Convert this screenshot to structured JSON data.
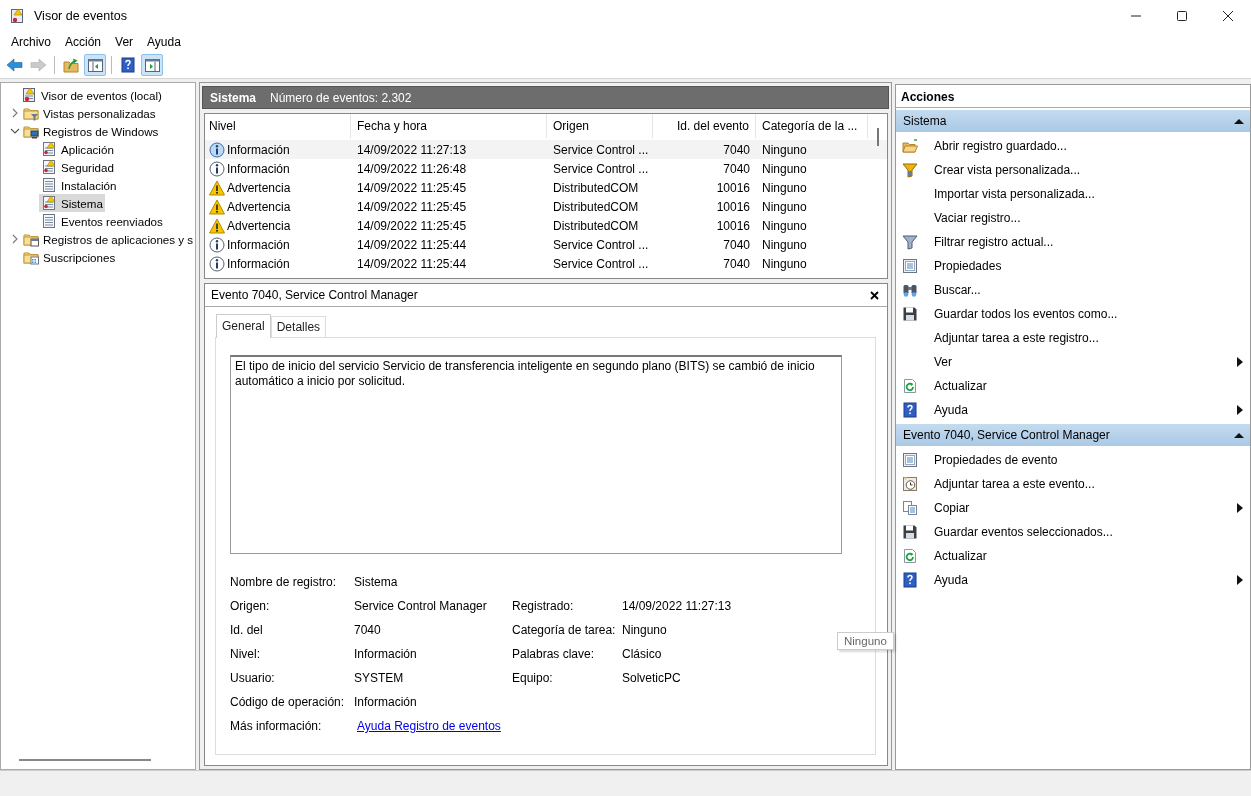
{
  "window": {
    "title": "Visor de eventos"
  },
  "menu": [
    "Archivo",
    "Acción",
    "Ver",
    "Ayuda"
  ],
  "toolbar": [
    {
      "kind": "back",
      "pressed": false,
      "disabled": false
    },
    {
      "kind": "forward",
      "pressed": false,
      "disabled": true
    },
    {
      "kind": "up",
      "pressed": false,
      "disabled": false
    },
    {
      "kind": "tree-pane",
      "pressed": true,
      "disabled": false
    },
    {
      "kind": "help",
      "pressed": false,
      "disabled": false
    },
    {
      "kind": "action-pane",
      "pressed": true,
      "disabled": false
    }
  ],
  "tree": [
    {
      "label": "Visor de eventos (local)",
      "kind": "viewer",
      "selected": false,
      "children": [
        {
          "label": "Vistas personalizadas",
          "kind": "folder-filter",
          "expanded": false,
          "selected": false
        },
        {
          "label": "Registros de Windows",
          "kind": "folder-computer",
          "expanded": true,
          "selected": false,
          "children": [
            {
              "label": "Aplicación",
              "kind": "log-alert",
              "selected": false
            },
            {
              "label": "Seguridad",
              "kind": "log-alert",
              "selected": false
            },
            {
              "label": "Instalación",
              "kind": "log",
              "selected": false
            },
            {
              "label": "Sistema",
              "kind": "log-alert",
              "selected": true
            },
            {
              "label": "Eventos reenviados",
              "kind": "log",
              "selected": false
            }
          ]
        },
        {
          "label": "Registros de aplicaciones y s",
          "kind": "folder-window",
          "expanded": false,
          "selected": false
        },
        {
          "label": "Suscripciones",
          "kind": "folder-subscription",
          "selected": false
        }
      ]
    }
  ],
  "events": {
    "log_name": "Sistema",
    "count": "Número de eventos: 2.302",
    "columns": [
      "Nivel",
      "Fecha y hora",
      "Origen",
      "Id. del evento",
      "Categoría de la ..."
    ],
    "rows": [
      {
        "kind": "info",
        "selected": true,
        "cells": [
          "Información",
          "14/09/2022 11:27:13",
          "Service Control ...",
          "7040",
          "Ninguno"
        ]
      },
      {
        "kind": "info",
        "selected": false,
        "cells": [
          "Información",
          "14/09/2022 11:26:48",
          "Service Control ...",
          "7040",
          "Ninguno"
        ]
      },
      {
        "kind": "warning",
        "selected": false,
        "cells": [
          "Advertencia",
          "14/09/2022 11:25:45",
          "DistributedCOM",
          "10016",
          "Ninguno"
        ]
      },
      {
        "kind": "warning",
        "selected": false,
        "cells": [
          "Advertencia",
          "14/09/2022 11:25:45",
          "DistributedCOM",
          "10016",
          "Ninguno"
        ]
      },
      {
        "kind": "warning",
        "selected": false,
        "cells": [
          "Advertencia",
          "14/09/2022 11:25:45",
          "DistributedCOM",
          "10016",
          "Ninguno"
        ]
      },
      {
        "kind": "info",
        "selected": false,
        "cells": [
          "Información",
          "14/09/2022 11:25:44",
          "Service Control ...",
          "7040",
          "Ninguno"
        ]
      },
      {
        "kind": "info",
        "selected": false,
        "cells": [
          "Información",
          "14/09/2022 11:25:44",
          "Service Control ...",
          "7040",
          "Ninguno"
        ]
      }
    ]
  },
  "detail": {
    "title": "Evento 7040, Service Control Manager",
    "tabs": [
      {
        "label": "General",
        "selected": true
      },
      {
        "label": "Detalles",
        "selected": false
      }
    ],
    "description": "El tipo de inicio del servicio Servicio de transferencia inteligente en segundo plano (BITS) se cambió de inicio automático a inicio por solicitud.",
    "fields": [
      [
        {
          "label": "Nombre de registro:",
          "value": "Sistema"
        }
      ],
      [
        {
          "label": "Origen:",
          "value": "Service Control Manager"
        },
        {
          "label": "Registrado:",
          "value": "14/09/2022 11:27:13"
        }
      ],
      [
        {
          "label": "Id. del",
          "value": "7040"
        },
        {
          "label": "Categoría de tarea:",
          "value": "Ninguno"
        }
      ],
      [
        {
          "label": "Nivel:",
          "value": "Información"
        },
        {
          "label": "Palabras clave:",
          "value": "Clásico"
        }
      ],
      [
        {
          "label": "Usuario:",
          "value": "SYSTEM"
        },
        {
          "label": "Equipo:",
          "value": "SolveticPC"
        }
      ],
      [
        {
          "label": "Código de operación:",
          "value": "Información"
        }
      ],
      [
        {
          "label": "Más información:",
          "value": "Ayuda Registro de eventos",
          "kind": "link"
        }
      ]
    ],
    "tooltip": "Ninguno"
  },
  "actions": {
    "title": "Acciones",
    "sections": [
      {
        "title": "Sistema",
        "expanded": true,
        "items": [
          {
            "label": "Abrir registro guardado...",
            "kind": "open",
            "submenu": false
          },
          {
            "label": "Crear vista personalizada...",
            "kind": "create-view",
            "submenu": false
          },
          {
            "label": "Importar vista personalizada...",
            "kind": "none",
            "submenu": false
          },
          {
            "label": "Vaciar registro...",
            "kind": "none",
            "submenu": false
          },
          {
            "label": "Filtrar registro actual...",
            "kind": "filter",
            "submenu": false
          },
          {
            "label": "Propiedades",
            "kind": "properties",
            "submenu": false
          },
          {
            "label": "Buscar...",
            "kind": "find",
            "submenu": false
          },
          {
            "label": "Guardar todos los eventos como...",
            "kind": "save",
            "submenu": false
          },
          {
            "label": "Adjuntar tarea a este registro...",
            "kind": "none",
            "submenu": false
          },
          {
            "label": "Ver",
            "kind": "none",
            "submenu": true
          },
          {
            "label": "Actualizar",
            "kind": "refresh",
            "submenu": false
          },
          {
            "label": "Ayuda",
            "kind": "help",
            "submenu": true
          }
        ]
      },
      {
        "title": "Evento 7040, Service Control Manager",
        "expanded": true,
        "items": [
          {
            "label": "Propiedades de evento",
            "kind": "properties",
            "submenu": false
          },
          {
            "label": "Adjuntar tarea a este evento...",
            "kind": "task",
            "submenu": false
          },
          {
            "label": "Copiar",
            "kind": "copy",
            "submenu": true
          },
          {
            "label": "Guardar eventos seleccionados...",
            "kind": "save",
            "submenu": false
          },
          {
            "label": "Actualizar",
            "kind": "refresh",
            "submenu": false
          },
          {
            "label": "Ayuda",
            "kind": "help",
            "submenu": true
          }
        ]
      }
    ]
  }
}
